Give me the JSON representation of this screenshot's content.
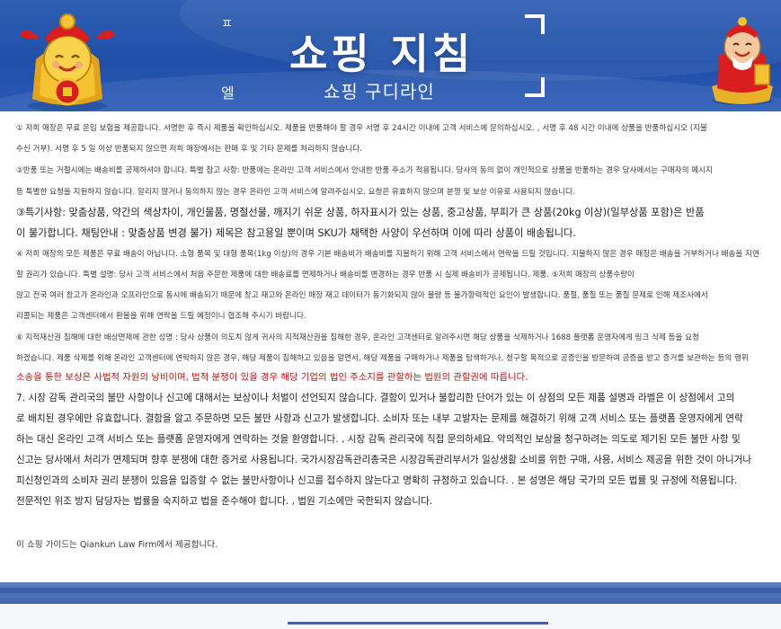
{
  "header": {
    "title": "쇼핑 지침",
    "subtitle": "쇼핑 구디라인",
    "mini_text_top": "ㅍ",
    "mini_text_bottom": "엘"
  },
  "paragraphs": [
    {
      "text": "① 저희 매장은 무료 운임 보험을 제공합니다. 서명한 후 즉시 제품을 확인하십시오. 제품을 반품해야 할 경우 서명 후 24시간 이내에 고객 서비스에 문의하십시오. , 서명 후 48 시간 이내에 상품을 반품하십시오 (지불"
    },
    {
      "text": "수신 거부). 서명 후 5 일 이상 반품되지 않으면 저희 매장에서는 판매 후 및 기타 문제를 처리하지 않습니다."
    },
    {
      "text": "②반품 또는 거절시에는 배송비를 공제하셔야 합니다. 특별 참고 사항: 반품에는 온라인 고객 서비스에서 안내한 반품 주소가 적용됩니다. 당사의 동의 없이 개인적으로 상품을 반품하는 경우 당사에서는 구매자의 메시지"
    },
    {
      "text": "등 특별한 요청을 지원하지 않습니다. 알리지 않거나 동의하지 않는 경우 온라인 고객 서비스에 알려주십시오. 요청은 유효하지 않으며 분쟁 및 보상 이유로 사용되지 않습니다."
    },
    {
      "text": "③특기사항: 맞춤상품, 약간의 색상차이, 개인물품, 명절선물, 깨지기 쉬운 상품, 하자표시가 있는 상품, 중고상품, 부피가 큰 상품(20kg 이상)(일부상품 포함)은 반품"
    },
    {
      "text": "이 불가합니다. 채팅안내 : 맞춤상품 변경 불가) 제목은 참고용일 뿐이며 SKU가 채택한 사양이 우선하며 이에 따라 상품이 배송됩니다."
    },
    {
      "text": "④ 저희 매장의 모든 제품은 무료 배송이 아닙니다. 소형 품목 및 대형 품목(1kg 이상)의 경우 기본 배송비가 배송비를 지불하기 위해 고객 서비스에서 연락을 드릴 것입니다. 지불하지 않은 경우 매장은 배송을 거부하거나 배송을 지연"
    },
    {
      "text": "할 권리가 있습니다. 특별 설명: 당사 고객 서비스에서 처음 주문한 제품에 대한 배송료를 면제하거나 배송비를 변경하는 경우 반품 시 실제 배송비가 공제됩니다. 제품. ⑤저희 매장의 상품수량이"
    },
    {
      "text": "많고 전국 여러 창고가 온라인과 오프라인으로 동시에 배송되기 때문에 창고 재고와 온라인 매장 재고 데이터가 동기화되지 않아 불량 등 불가항력적인 요인이 발생합니다. 품절, 품질 또는 품질 문제로 인해 제조사에서"
    },
    {
      "text": "리콜되는 제품은 고객센터에서 환불을 위해 연락을 드릴 예정이니 협조해 주시기 바랍니다."
    },
    {
      "text": "⑥ 지적재산권 침해에 대한 배상면제에 관한 성명 : 당사 상품이 의도치 않게 귀사의 지적재산권을 침해한 경우, 온라인 고객센터로 알려주시면 해당 상품을 삭제하거나 1688 플랫폼 운영자에게 링크 삭제 등을 요청"
    },
    {
      "text": "하겠습니다. 제품 삭제를 위해 온라인 고객센터에 연락하지 않은 경우, 해당 제품이 침해하고 있음을 알면서, 해당 제품을 구매하거나 제품을 탐색하거나, 청구할 목적으로 공증인을 방문하여 공증을 받고 증거를 보관하는 등의 행위"
    },
    {
      "text": "소송을 통한 보상은 사법적 자원의 낭비이며, 법적 분쟁이 있을 경우 해당 기업의 법인 주소지를 관할하는 법원의 관할권에 따릅니다."
    },
    {
      "text": "7. 시장 감독 관리국의 불만 사항이나 신고에 대해서는 보상이나 처벌이 선언되지 않습니다. 결함이 있거나 불합리한 단어가 있는 이 상점의 모든 제품 설명과 라벨은 이 상점에서 고의"
    },
    {
      "text": "로 배치된 경우에만 유효합니다. 결함을 알고 주문하면 모든 불만 사항과 신고가 발생합니다. 소비자 또는 내부 고발자는 문제를 해결하기 위해 고객 서비스 또는 플랫폼 운영자에게 연락"
    },
    {
      "text": "하는 대신 온라인 고객 서비스 또는 플랫폼 운영자에게 연락하는 것을 환영합니다. , 시장 감독 관리국에 직접 문의하세요. 악의적인 보상을 청구하려는 의도로 제기된 모든 불만 사항 및"
    },
    {
      "text": "신고는 당사에서 처리가 면제되며 향후 분쟁에 대한 증거로 사용됩니다. 국가시장감독관리총국은 시장감독관리부서가 일상생활 소비를 위한 구매, 사용, 서비스 제공을 위한 것이 아니거나"
    },
    {
      "text": "피신청인과의 소비자 권리 분쟁이 있음을 입증할 수 없는 불만사항이나 신고를 접수하지 않는다고 명확히 규정하고 있습니다. . 본 성명은 해당 국가의 모든 법률 및 규정에 적용됩니다."
    },
    {
      "text": "전문적인 위조 방지 담당자는 법률을 숙지하고 법을 준수해야 합니다. , 법원 기소에만 국한되지 않습니다."
    },
    {
      "text": "이 쇼핑 가이드는 Qiankun Law Firm에서 제공합니다."
    }
  ],
  "colors": {
    "banner_blue": "#1f4fa8",
    "warning_red": "#c40f0f",
    "body_text": "#3a3a3a"
  },
  "icons": {
    "left_decor": "god-of-wealth-left-icon",
    "right_decor": "god-of-wealth-right-icon"
  }
}
